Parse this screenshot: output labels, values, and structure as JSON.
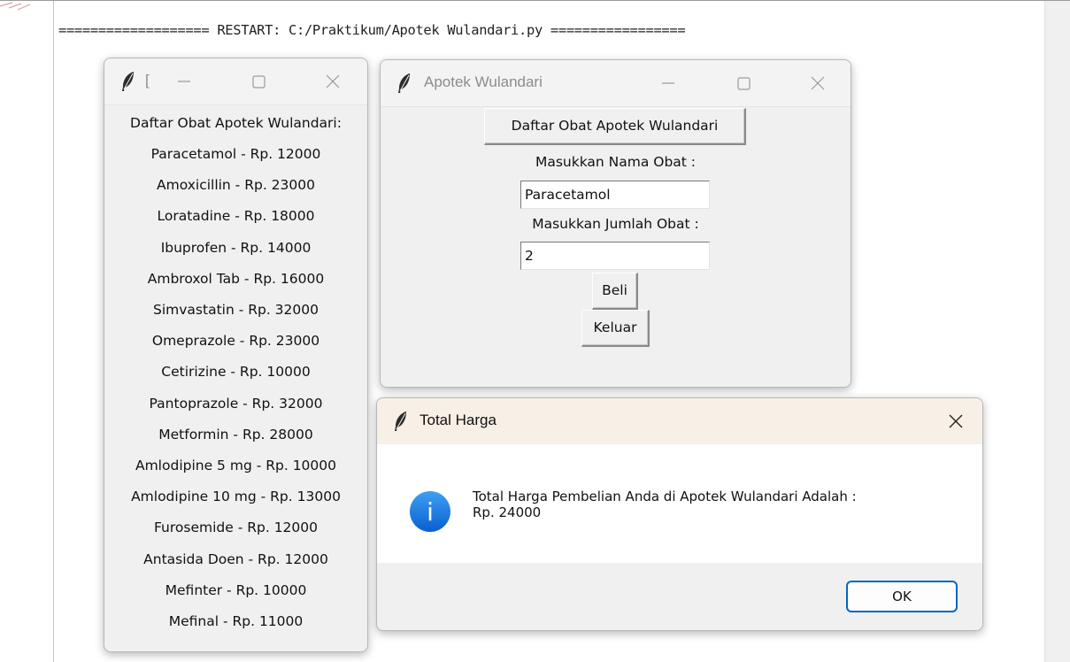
{
  "shell": {
    "restart_line": "=================== RESTART: C:/Praktikum/Apotek Wulandari.py ================="
  },
  "list_window": {
    "title": "[",
    "heading": "Daftar Obat Apotek Wulandari:",
    "items": [
      "Paracetamol - Rp. 12000",
      "Amoxicillin - Rp. 23000",
      "Loratadine - Rp. 18000",
      "Ibuprofen - Rp. 14000",
      "Ambroxol Tab - Rp. 16000",
      "Simvastatin - Rp. 32000",
      "Omeprazole - Rp. 23000",
      "Cetirizine - Rp. 10000",
      "Pantoprazole - Rp. 32000",
      "Metformin - Rp. 28000",
      "Amlodipine 5 mg - Rp. 10000",
      "Amlodipine 10 mg - Rp. 13000",
      "Furosemide - Rp. 12000",
      "Antasida Doen - Rp. 12000",
      "Mefinter - Rp. 10000",
      "Mefinal - Rp. 11000"
    ]
  },
  "main_window": {
    "title": "Apotek Wulandari",
    "list_button": "Daftar Obat Apotek Wulandari",
    "name_label": "Masukkan Nama Obat :",
    "name_value": "Paracetamol",
    "qty_label": "Masukkan Jumlah Obat :",
    "qty_value": "2",
    "buy_button": "Beli",
    "exit_button": "Keluar"
  },
  "dialog": {
    "title": "Total Harga",
    "message_line1": "Total Harga Pembelian Anda di Apotek Wulandari Adalah :",
    "message_line2": "Rp. 24000",
    "ok_button": "OK",
    "info_icon_glyph": "i"
  },
  "icons": {
    "feather": "feather-icon",
    "minimize": "minimize-icon",
    "maximize": "maximize-icon",
    "close": "close-icon",
    "info": "info-icon"
  },
  "colors": {
    "window_bg": "#f0f0f0",
    "dialog_title_bg": "#f8efe6",
    "info_blue": "#1a73e8",
    "ok_border": "#0067c0"
  }
}
